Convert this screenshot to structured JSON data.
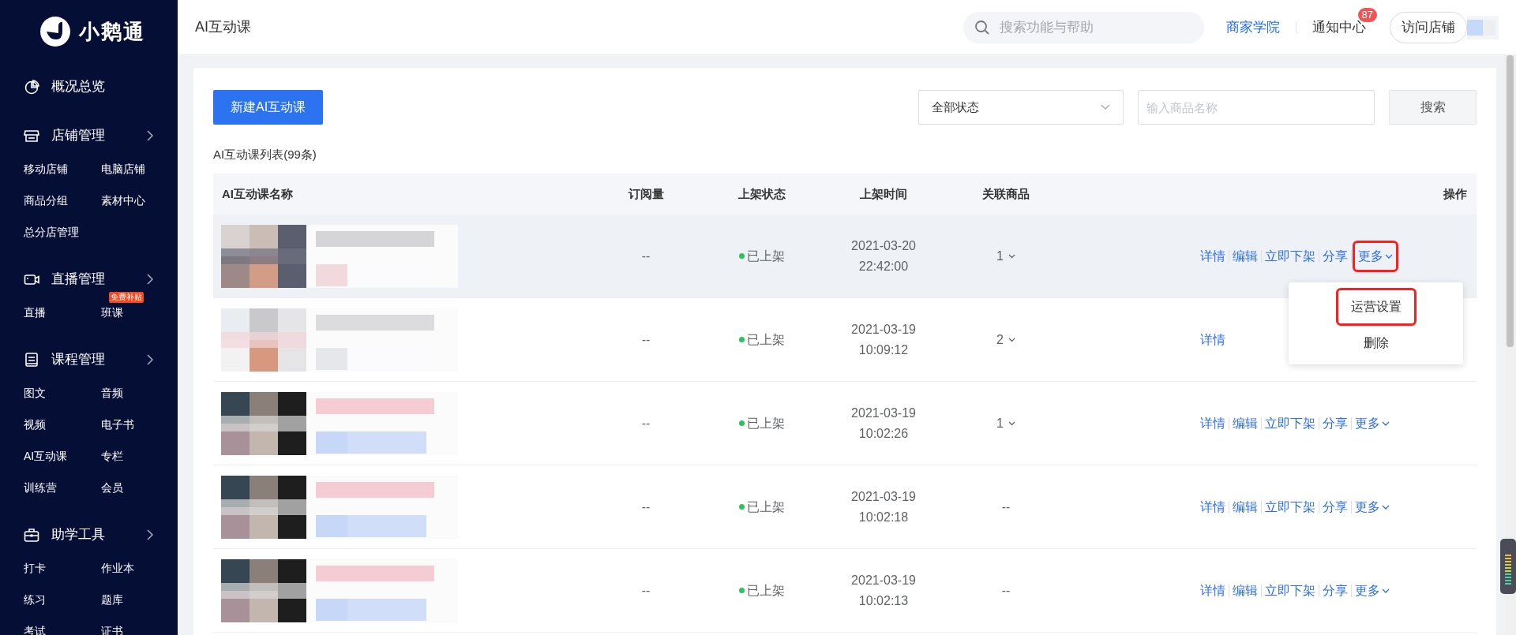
{
  "sidebar": {
    "logo": "小鹅通",
    "groups": [
      {
        "title": "概况总览",
        "has_arrow": false
      },
      {
        "title": "店铺管理",
        "has_arrow": true,
        "items": [
          {
            "label": "移动店铺"
          },
          {
            "label": "电脑店铺"
          },
          {
            "label": "商品分组"
          },
          {
            "label": "素材中心"
          },
          {
            "label": "总分店管理"
          }
        ]
      },
      {
        "title": "直播管理",
        "has_arrow": true,
        "items": [
          {
            "label": "直播"
          },
          {
            "label": "班课",
            "badge": "免费补贴"
          }
        ]
      },
      {
        "title": "课程管理",
        "has_arrow": true,
        "items": [
          {
            "label": "图文"
          },
          {
            "label": "音频"
          },
          {
            "label": "视频"
          },
          {
            "label": "电子书"
          },
          {
            "label": "AI互动课"
          },
          {
            "label": "专栏"
          },
          {
            "label": "训练营"
          },
          {
            "label": "会员"
          }
        ]
      },
      {
        "title": "助学工具",
        "has_arrow": true,
        "items": [
          {
            "label": "打卡"
          },
          {
            "label": "作业本"
          },
          {
            "label": "练习"
          },
          {
            "label": "题库"
          },
          {
            "label": "考试"
          },
          {
            "label": "证书"
          }
        ]
      }
    ]
  },
  "header": {
    "title": "AI互动课",
    "search": {
      "placeholder": "搜索功能与帮助"
    },
    "links": [
      "商家学院"
    ],
    "notifications": {
      "label": "通知中心",
      "count": "87"
    },
    "visit_button": "访问店铺"
  },
  "toolbar": {
    "create_button": "新建AI互动课",
    "status_select": "全部状态",
    "name_input": {
      "placeholder": "输入商品名称"
    },
    "search_button": "搜索"
  },
  "list_title": "AI互动课列表(99条)",
  "table": {
    "columns": [
      "AI互动课名称",
      "订阅量",
      "上架状态",
      "上架时间",
      "关联商品",
      "操作"
    ],
    "rows": [
      {
        "subscriptions": "--",
        "status": "已上架",
        "date": "2021-03-20",
        "time": "22:42:00",
        "related": "1",
        "expandable": true,
        "hovered": true,
        "actions": [
          {
            "label": "详情"
          },
          {
            "label": "编辑"
          },
          {
            "label": "立即下架"
          },
          {
            "label": "分享"
          },
          {
            "label": "更多",
            "dropdown": true,
            "highlighted": true
          }
        ]
      },
      {
        "subscriptions": "--",
        "status": "已上架",
        "date": "2021-03-19",
        "time": "10:09:12",
        "related": "2",
        "expandable": true,
        "hovered": false,
        "actions": [
          {
            "label": "详情"
          }
        ]
      },
      {
        "subscriptions": "--",
        "status": "已上架",
        "date": "2021-03-19",
        "time": "10:02:26",
        "related": "1",
        "expandable": true,
        "hovered": false,
        "actions": [
          {
            "label": "详情"
          },
          {
            "label": "编辑"
          },
          {
            "label": "立即下架"
          },
          {
            "label": "分享"
          },
          {
            "label": "更多",
            "dropdown": true,
            "highlighted": false
          }
        ]
      },
      {
        "subscriptions": "--",
        "status": "已上架",
        "date": "2021-03-19",
        "time": "10:02:18",
        "related": "--",
        "expandable": false,
        "hovered": false,
        "actions": [
          {
            "label": "详情"
          },
          {
            "label": "编辑"
          },
          {
            "label": "立即下架"
          },
          {
            "label": "分享"
          },
          {
            "label": "更多",
            "dropdown": true,
            "highlighted": false
          }
        ]
      },
      {
        "subscriptions": "--",
        "status": "已上架",
        "date": "2021-03-19",
        "time": "10:02:13",
        "related": "--",
        "expandable": false,
        "hovered": false,
        "actions": [
          {
            "label": "详情"
          },
          {
            "label": "编辑"
          },
          {
            "label": "立即下架"
          },
          {
            "label": "分享"
          },
          {
            "label": "更多",
            "dropdown": true,
            "highlighted": false
          }
        ]
      }
    ]
  },
  "more_menu": {
    "items": [
      {
        "label": "运营设置",
        "highlighted": true
      },
      {
        "label": "删除",
        "highlighted": false
      }
    ]
  }
}
